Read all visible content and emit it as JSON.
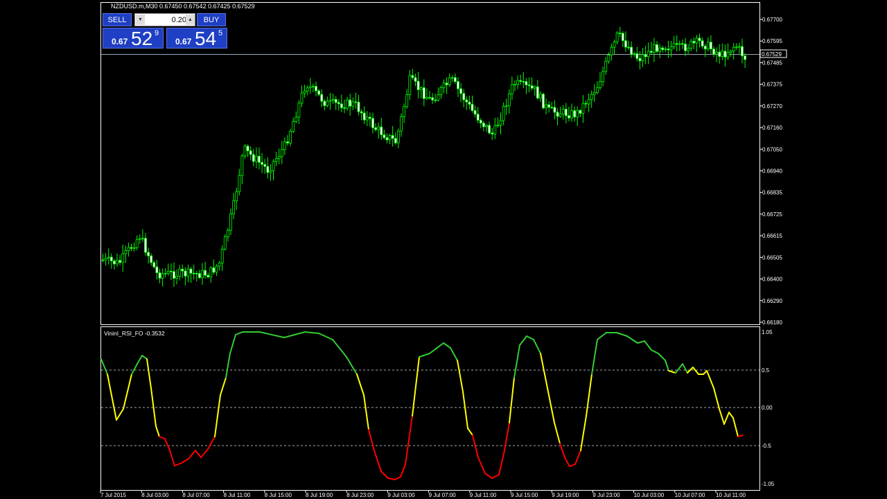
{
  "header": {
    "symbol_info": "NZDUSD.m,M30  0.67450 0.67542 0.67425 0.67529"
  },
  "trade_panel": {
    "sell_label": "SELL",
    "buy_label": "BUY",
    "lot_value": "0.20",
    "sell_price_prefix": "0.67",
    "sell_price_main": "52",
    "sell_price_sup": "9",
    "buy_price_prefix": "0.67",
    "buy_price_main": "54",
    "buy_price_sup": "5"
  },
  "price_axis": {
    "labels": [
      "0.67700",
      "0.67595",
      "0.67485",
      "0.67375",
      "0.67270",
      "0.67160",
      "0.67050",
      "0.66940",
      "0.66835",
      "0.66725",
      "0.66615",
      "0.66505",
      "0.66400",
      "0.66290",
      "0.66180"
    ],
    "current_price": "0.67529"
  },
  "indicator": {
    "title": "VininI_RSI_FO -0.3532",
    "levels": [
      "1.05",
      "0.5",
      "0.00",
      "-0.5",
      "-1.05"
    ]
  },
  "time_axis": {
    "labels": [
      "7 Jul 2015",
      "8 Jul 03:00",
      "8 Jul 07:00",
      "8 Jul 11:00",
      "8 Jul 15:00",
      "8 Jul 19:00",
      "8 Jul 23:00",
      "9 Jul 03:00",
      "9 Jul 07:00",
      "9 Jul 11:00",
      "9 Jul 15:00",
      "9 Jul 19:00",
      "9 Jul 23:00",
      "10 Jul 03:00",
      "10 Jul 07:00",
      "10 Jul 11:00"
    ]
  },
  "colors": {
    "candle": "#00ff00",
    "bull_body": "#000000",
    "bear_body": "#ffffff",
    "rsi_green": "#32cd32",
    "rsi_yellow": "#ffff00",
    "rsi_red": "#ff0000",
    "button_blue": "#1f3fc4"
  }
}
